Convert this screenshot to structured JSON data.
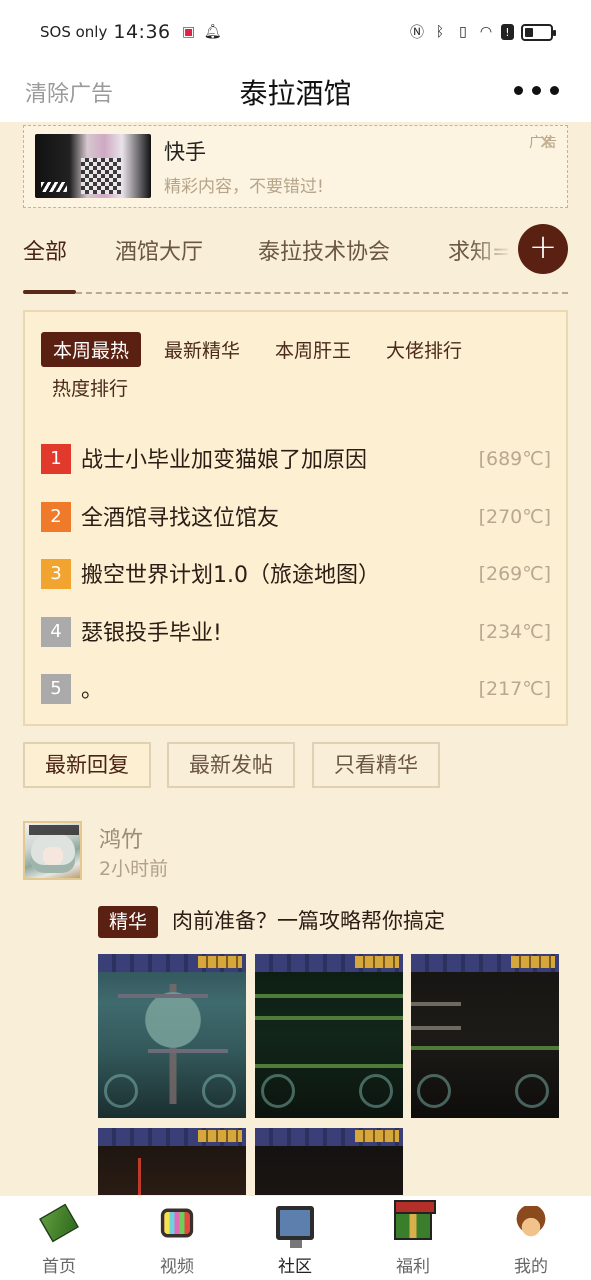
{
  "status_bar": {
    "carrier": "SOS only",
    "time": "14:36",
    "right_icons": [
      "nfc-icon",
      "bluetooth-icon",
      "vibrate-icon",
      "wifi-icon",
      "alert-icon",
      "battery-icon"
    ]
  },
  "header": {
    "clear_ads": "清除广告",
    "title": "泰拉酒馆"
  },
  "ad": {
    "name": "快手",
    "description": "精彩内容，不要错过!",
    "tag": "广告"
  },
  "categories": [
    "全部",
    "酒馆大厅",
    "泰拉技术协会",
    "求知="
  ],
  "ranking": {
    "tabs": [
      "本周最热",
      "最新精华",
      "本周肝王",
      "大佬排行",
      "热度排行"
    ],
    "items": [
      {
        "num": "1",
        "title": "战士小毕业加变猫娘了加原因",
        "heat": "[689℃]",
        "color": "#e1392b"
      },
      {
        "num": "2",
        "title": "全酒馆寻找这位馆友",
        "heat": "[270℃]",
        "color": "#ef7a29"
      },
      {
        "num": "3",
        "title": "搬空世界计划1.0（旅途地图）",
        "heat": "[269℃]",
        "color": "#f2a431"
      },
      {
        "num": "4",
        "title": "瑟银投手毕业!",
        "heat": "[234℃]",
        "color": "#aaaaaa"
      },
      {
        "num": "5",
        "title": "。",
        "heat": "[217℃]",
        "color": "#aaaaaa"
      }
    ]
  },
  "sort_buttons": [
    "最新回复",
    "最新发帖",
    "只看精华"
  ],
  "post": {
    "author": "鸿竹",
    "time": "2小时前",
    "tag": "精华",
    "title": "肉前准备？一篇攻略帮你搞定"
  },
  "bottom_nav": [
    "首页",
    "视频",
    "社区",
    "福利",
    "我的"
  ]
}
